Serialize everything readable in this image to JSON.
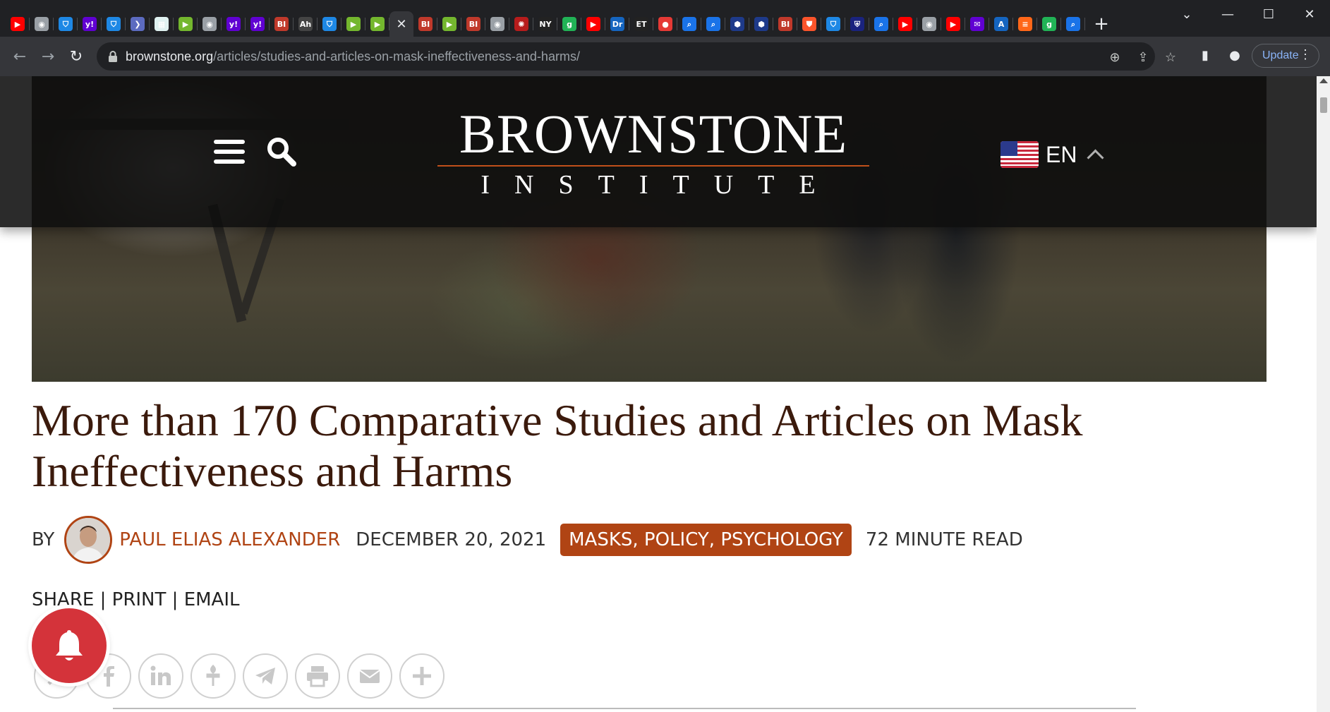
{
  "browser": {
    "tabs": [
      {
        "icon": "youtube-icon",
        "color": "#ff0000",
        "glyph": "▶"
      },
      {
        "icon": "globe-icon",
        "color": "#9aa0a6",
        "glyph": "◉"
      },
      {
        "icon": "shield-icon",
        "color": "#1e88e5",
        "glyph": "⛉"
      },
      {
        "icon": "yahoo-icon",
        "color": "#6001d2",
        "glyph": "y!"
      },
      {
        "icon": "shield-icon",
        "color": "#1e88e5",
        "glyph": "⛉"
      },
      {
        "icon": "arrow-icon",
        "color": "#5c6bc0",
        "glyph": "❯"
      },
      {
        "icon": "map-icon",
        "color": "#e0f2f1",
        "glyph": "▦"
      },
      {
        "icon": "rumble-icon",
        "color": "#74b72e",
        "glyph": "▶"
      },
      {
        "icon": "globe-icon",
        "color": "#9aa0a6",
        "glyph": "◉"
      },
      {
        "icon": "yahoo-icon",
        "color": "#6001d2",
        "glyph": "y!"
      },
      {
        "icon": "yahoo-icon",
        "color": "#6001d2",
        "glyph": "y!"
      },
      {
        "icon": "brownstone-icon",
        "color": "#c0392b",
        "glyph": "BI"
      },
      {
        "icon": "ah-icon",
        "color": "#444",
        "glyph": "Ah"
      },
      {
        "icon": "shield-icon",
        "color": "#1e88e5",
        "glyph": "⛉"
      },
      {
        "icon": "rumble-icon",
        "color": "#74b72e",
        "glyph": "▶"
      },
      {
        "icon": "rumble-icon",
        "color": "#74b72e",
        "glyph": "▶"
      },
      {
        "icon": "close-icon",
        "color": "#35363a",
        "glyph": "✕",
        "active": true
      },
      {
        "icon": "brownstone-icon",
        "color": "#c0392b",
        "glyph": "BI"
      },
      {
        "icon": "rumble-icon",
        "color": "#74b72e",
        "glyph": "▶"
      },
      {
        "icon": "brownstone-icon",
        "color": "#c0392b",
        "glyph": "BI"
      },
      {
        "icon": "globe-icon",
        "color": "#9aa0a6",
        "glyph": "◉"
      },
      {
        "icon": "burst-icon",
        "color": "#b71c1c",
        "glyph": "✺"
      },
      {
        "icon": "nyp-icon",
        "color": "#222",
        "glyph": "NY"
      },
      {
        "icon": "gettr-icon",
        "color": "#21b356",
        "glyph": "g"
      },
      {
        "icon": "youtube-icon",
        "color": "#ff0000",
        "glyph": "▶"
      },
      {
        "icon": "drudge-icon",
        "color": "#1565c0",
        "glyph": "Dr"
      },
      {
        "icon": "epoch-times-icon",
        "color": "#222",
        "glyph": "ET"
      },
      {
        "icon": "podcast-icon",
        "color": "#e53935",
        "glyph": "●"
      },
      {
        "icon": "search-icon",
        "color": "#1a73e8",
        "glyph": "⌕"
      },
      {
        "icon": "search-icon",
        "color": "#1a73e8",
        "glyph": "⌕"
      },
      {
        "icon": "cube-icon",
        "color": "#1e3a8a",
        "glyph": "⬢"
      },
      {
        "icon": "cube-icon",
        "color": "#1e3a8a",
        "glyph": "⬢"
      },
      {
        "icon": "brownstone-icon",
        "color": "#c0392b",
        "glyph": "BI"
      },
      {
        "icon": "brave-icon",
        "color": "#fb542b",
        "glyph": "⛊"
      },
      {
        "icon": "shield-icon",
        "color": "#1e88e5",
        "glyph": "⛉"
      },
      {
        "icon": "crest-icon",
        "color": "#1a237e",
        "glyph": "⛨"
      },
      {
        "icon": "search-icon",
        "color": "#1a73e8",
        "glyph": "⌕"
      },
      {
        "icon": "youtube-icon",
        "color": "#ff0000",
        "glyph": "▶"
      },
      {
        "icon": "globe-icon",
        "color": "#9aa0a6",
        "glyph": "◉"
      },
      {
        "icon": "youtube-icon",
        "color": "#ff0000",
        "glyph": "▶"
      },
      {
        "icon": "yahoo-mail-icon",
        "color": "#6001d2",
        "glyph": "✉"
      },
      {
        "icon": "letter-a-icon",
        "color": "#1565c0",
        "glyph": "A"
      },
      {
        "icon": "substack-icon",
        "color": "#ff6719",
        "glyph": "≡"
      },
      {
        "icon": "gettr-icon",
        "color": "#21b356",
        "glyph": "g"
      },
      {
        "icon": "search-icon",
        "color": "#1a73e8",
        "glyph": "⌕"
      }
    ],
    "url_host": "brownstone.org",
    "url_path": "/articles/studies-and-articles-on-mask-ineffectiveness-and-harms/",
    "update_label": "Update"
  },
  "site": {
    "logo_line1": "BROWNSTONE",
    "logo_line2": "INSTITUTE",
    "language": "EN",
    "accent_color": "#b04414"
  },
  "article": {
    "title": "More than 170 Comparative Studies and Articles on Mask Ineffectiveness and Harms",
    "by_label": "BY",
    "author": "PAUL ELIAS ALEXANDER",
    "date": "DECEMBER 20, 2021",
    "categories": "MASKS, POLICY, PSYCHOLOGY",
    "read_time": "72 MINUTE READ",
    "share_label": "SHARE",
    "print_label": "PRINT",
    "email_label": "EMAIL",
    "separator": "|",
    "social_buttons": [
      "x-icon",
      "facebook-icon",
      "linkedin-icon",
      "gettr-icon",
      "telegram-icon",
      "printer-icon",
      "email-icon",
      "plus-icon"
    ]
  }
}
